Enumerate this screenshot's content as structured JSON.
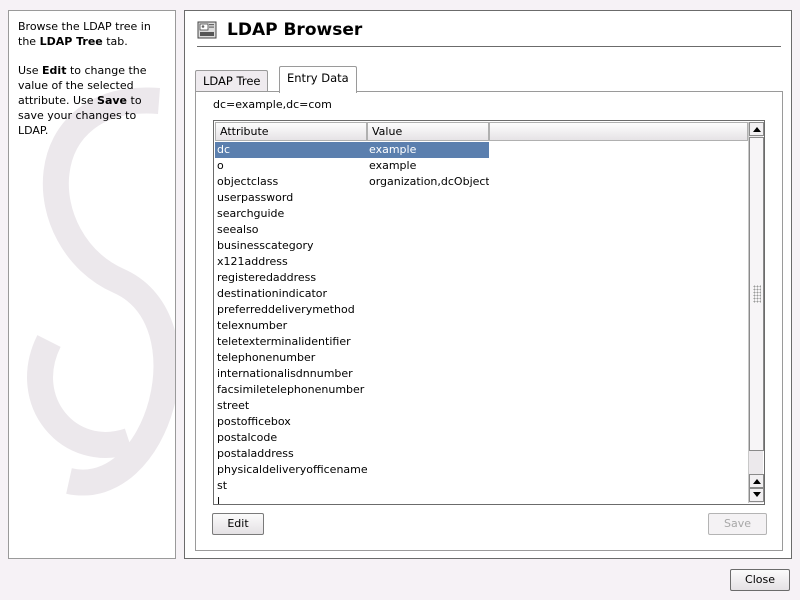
{
  "help": {
    "p1_a": "Browse the LDAP tree in the ",
    "p1_b": "LDAP Tree",
    "p1_c": " tab.",
    "p2_a": "Use ",
    "p2_b": "Edit",
    "p2_c": " to change the value of the selected attribute. Use ",
    "p2_d": "Save",
    "p2_e": " to save your changes to LDAP."
  },
  "header": {
    "title": "LDAP Browser"
  },
  "tabs": [
    {
      "label": "LDAP Tree",
      "active": false
    },
    {
      "label": "Entry Data",
      "active": true
    }
  ],
  "entry": {
    "dn": "dc=example,dc=com"
  },
  "table": {
    "columns": [
      "Attribute",
      "Value"
    ],
    "selected_index": 0,
    "rows": [
      {
        "attr": "dc",
        "value": "example"
      },
      {
        "attr": "o",
        "value": "example"
      },
      {
        "attr": "objectclass",
        "value": "organization,dcObject"
      },
      {
        "attr": "userpassword",
        "value": ""
      },
      {
        "attr": "searchguide",
        "value": ""
      },
      {
        "attr": "seealso",
        "value": ""
      },
      {
        "attr": "businesscategory",
        "value": ""
      },
      {
        "attr": "x121address",
        "value": ""
      },
      {
        "attr": "registeredaddress",
        "value": ""
      },
      {
        "attr": "destinationindicator",
        "value": ""
      },
      {
        "attr": "preferreddeliverymethod",
        "value": ""
      },
      {
        "attr": "telexnumber",
        "value": ""
      },
      {
        "attr": "teletexterminalidentifier",
        "value": ""
      },
      {
        "attr": "telephonenumber",
        "value": ""
      },
      {
        "attr": "internationalisdnnumber",
        "value": ""
      },
      {
        "attr": "facsimiletelephonenumber",
        "value": ""
      },
      {
        "attr": "street",
        "value": ""
      },
      {
        "attr": "postofficebox",
        "value": ""
      },
      {
        "attr": "postalcode",
        "value": ""
      },
      {
        "attr": "postaladdress",
        "value": ""
      },
      {
        "attr": "physicaldeliveryofficename",
        "value": ""
      },
      {
        "attr": "st",
        "value": ""
      },
      {
        "attr": "l",
        "value": ""
      }
    ]
  },
  "buttons": {
    "edit_label": "Edit",
    "save_label": "Save",
    "save_enabled": false,
    "close_label": "Close"
  },
  "icons": {
    "title": "ldap-browser-icon",
    "scroll_up": "arrow-up-icon",
    "scroll_down": "arrow-down-icon"
  },
  "colors": {
    "selection": "#5b7fae",
    "window_bg": "#f6f2f6"
  }
}
